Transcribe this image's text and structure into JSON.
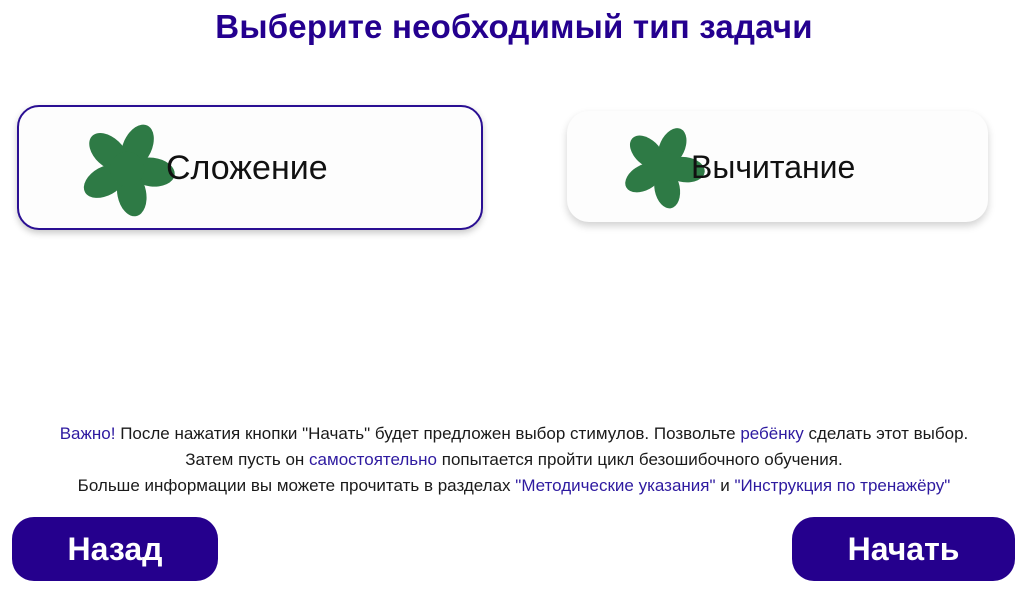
{
  "page": {
    "title": "Выберите необходимый тип задачи"
  },
  "tasks": [
    {
      "label": "Сложение",
      "icon": "flower-icon",
      "selected": true
    },
    {
      "label": "Вычитание",
      "icon": "flower-icon",
      "selected": false
    }
  ],
  "info": {
    "line1": {
      "important": "Важно",
      "bang": "!",
      "part1": " После нажатия кнопки \"Начать\" будет предложен выбор стимулов. Позвольте ",
      "child": "ребёнку",
      "part2": " сделать этот выбор."
    },
    "line2": {
      "part1": "Затем пусть он ",
      "self": "самостоятельно",
      "part2": " попытается пройти цикл безошибочного обучения."
    },
    "line3": {
      "part1": "Больше информации вы можете прочитать в разделах ",
      "link_methods": "\"Методические указания\"",
      "and": " и ",
      "link_instructions": "\"Инструкция по тренажёру\""
    }
  },
  "buttons": {
    "back": "Назад",
    "start": "Начать"
  },
  "colors": {
    "title": "#24008f",
    "button_bg": "#25008d",
    "accent_text": "#2e1aa0",
    "flower": "#2e7a45",
    "selected_border": "#2a0f93"
  }
}
